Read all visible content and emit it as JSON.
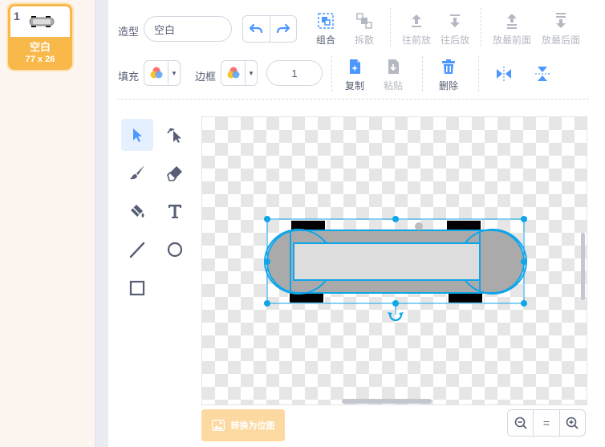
{
  "costume_list": {
    "items": [
      {
        "number": "1",
        "name": "空白",
        "size": "77 x 26",
        "selected": true
      }
    ]
  },
  "toolbar": {
    "costume_label": "造型",
    "costume_name": "空白",
    "group": "组合",
    "ungroup": "拆散",
    "forward": "往前放",
    "backward": "往后放",
    "front": "放最前面",
    "back": "放最后面",
    "fill_label": "填充",
    "outline_label": "边框",
    "outline_width": "1",
    "copy": "复制",
    "paste": "粘贴",
    "delete": "删除"
  },
  "canvas_footer": {
    "convert_bitmap": "转换为位图",
    "zoom_reset": "="
  },
  "colors": {
    "accent": "#f9b84a",
    "selection": "#0ea5e9",
    "tool_active_bg": "#e5f0ff",
    "icon_blue": "#4c97ff",
    "icon_disabled": "#b4b8c2",
    "shape_fill": "#aaaaaa",
    "bitmap_button": "#fcd9a0"
  }
}
